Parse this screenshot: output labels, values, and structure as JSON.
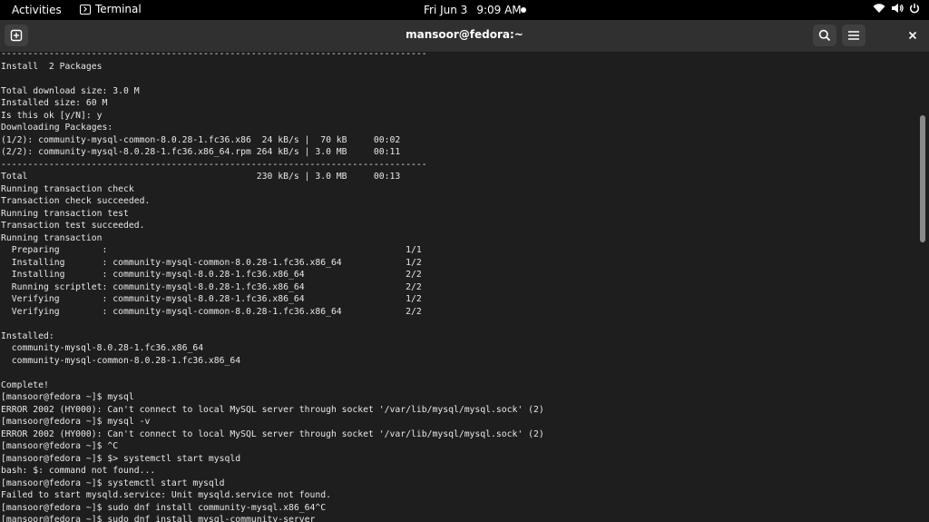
{
  "topbar": {
    "activities": "Activities",
    "app_name": "Terminal",
    "date": "Fri Jun 3",
    "time": "9:09 AM"
  },
  "window": {
    "title": "mansoor@fedora:~"
  },
  "terminal": {
    "lines": [
      "--------------------------------------------------------------------------------",
      "Install  2 Packages",
      "",
      "Total download size: 3.0 M",
      "Installed size: 60 M",
      "Is this ok [y/N]: y",
      "Downloading Packages:",
      "(1/2): community-mysql-common-8.0.28-1.fc36.x86  24 kB/s |  70 kB     00:02",
      "(2/2): community-mysql-8.0.28-1.fc36.x86_64.rpm 264 kB/s | 3.0 MB     00:11",
      "--------------------------------------------------------------------------------",
      "Total                                           230 kB/s | 3.0 MB     00:13",
      "Running transaction check",
      "Transaction check succeeded.",
      "Running transaction test",
      "Transaction test succeeded.",
      "Running transaction",
      "  Preparing        :                                                        1/1",
      "  Installing       : community-mysql-common-8.0.28-1.fc36.x86_64            1/2",
      "  Installing       : community-mysql-8.0.28-1.fc36.x86_64                   2/2",
      "  Running scriptlet: community-mysql-8.0.28-1.fc36.x86_64                   2/2",
      "  Verifying        : community-mysql-8.0.28-1.fc36.x86_64                   1/2",
      "  Verifying        : community-mysql-common-8.0.28-1.fc36.x86_64            2/2",
      "",
      "Installed:",
      "  community-mysql-8.0.28-1.fc36.x86_64",
      "  community-mysql-common-8.0.28-1.fc36.x86_64",
      "",
      "Complete!",
      "[mansoor@fedora ~]$ mysql",
      "ERROR 2002 (HY000): Can't connect to local MySQL server through socket '/var/lib/mysql/mysql.sock' (2)",
      "[mansoor@fedora ~]$ mysql -v",
      "ERROR 2002 (HY000): Can't connect to local MySQL server through socket '/var/lib/mysql/mysql.sock' (2)",
      "[mansoor@fedora ~]$ ^C",
      "[mansoor@fedora ~]$ $> systemctl start mysqld",
      "bash: $: command not found...",
      "[mansoor@fedora ~]$ systemctl start mysqld",
      "Failed to start mysqld.service: Unit mysqld.service not found.",
      "[mansoor@fedora ~]$ sudo dnf install community-mysql.x86_64^C",
      "[mansoor@fedora ~]$ sudo dnf install mysql-community-server"
    ]
  },
  "icons": {
    "app_menu": "terminal-icon",
    "new_tab": "new-tab-icon",
    "search": "search-icon",
    "menu": "hamburger-menu-icon",
    "close": "close-icon",
    "wifi": "wifi-icon",
    "volume": "volume-icon",
    "power": "power-icon"
  },
  "colors": {
    "topbar_bg": "#000000",
    "headerbar_bg": "#303030",
    "terminal_bg": "#1e1e1e",
    "terminal_fg": "#e8e8e8"
  }
}
